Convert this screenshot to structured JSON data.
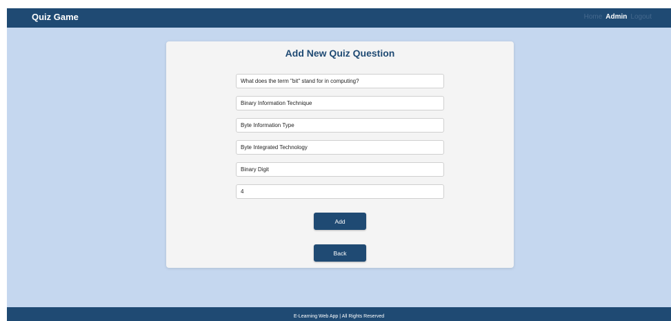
{
  "header": {
    "brand": "Quiz Game",
    "nav": {
      "home": "Home",
      "admin": "Admin",
      "logout": "Logout"
    }
  },
  "form": {
    "title": "Add New Quiz Question",
    "question": "What does the term \"bit\" stand for in computing?",
    "option1": "Binary Information Technique",
    "option2": "Byte Information Type",
    "option3": "Byte Integrated Technology",
    "option4": "Binary Digit",
    "correct_answer": "4",
    "add_label": "Add",
    "back_label": "Back"
  },
  "footer": {
    "text": "E-Learning Web App | All Rights Reserved"
  },
  "colors": {
    "primary": "#1f4a73",
    "background": "#c5d7ef",
    "card": "#f4f4f4"
  }
}
